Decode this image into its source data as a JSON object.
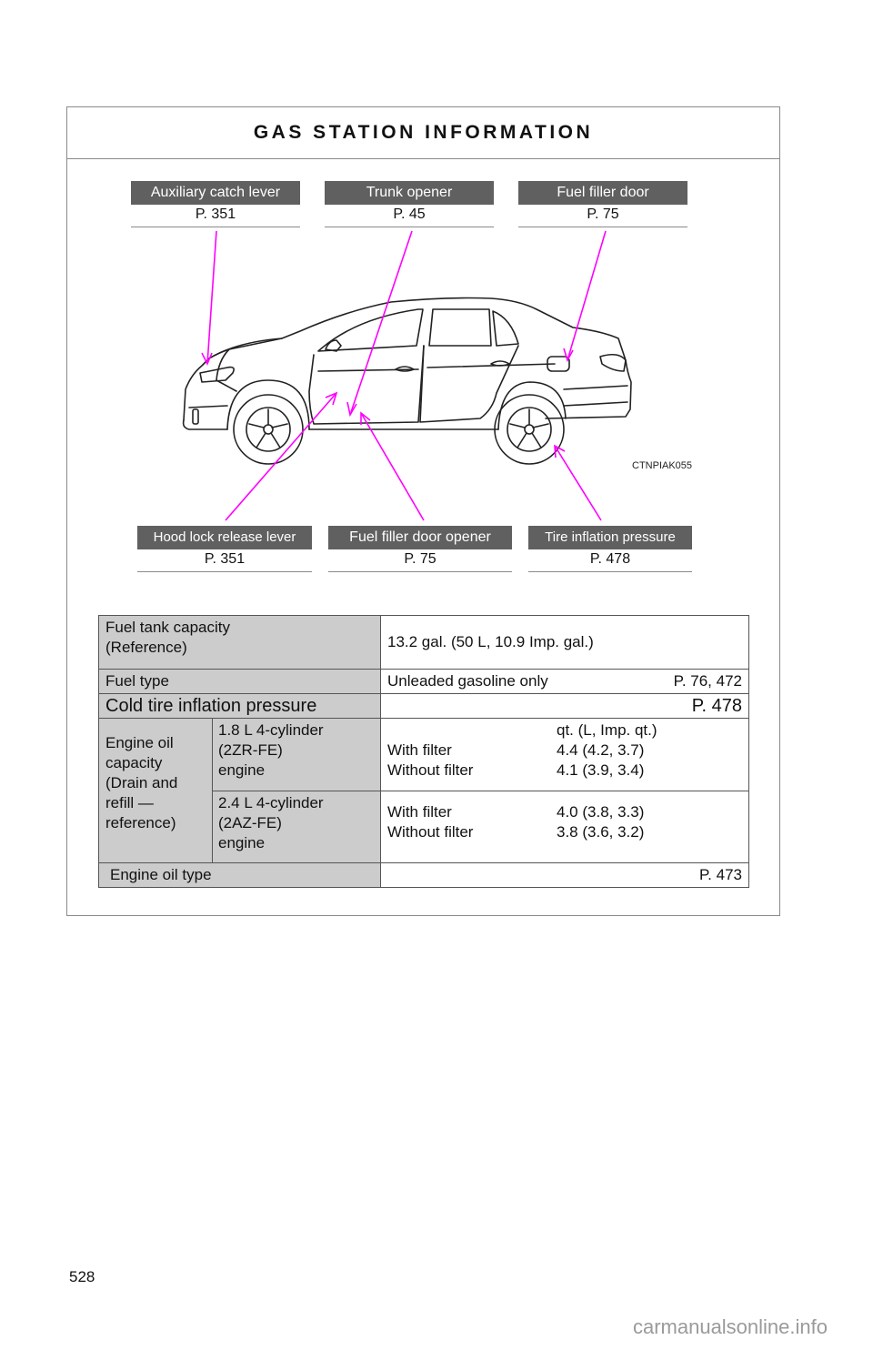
{
  "title": "GAS STATION INFORMATION",
  "callouts_top": [
    {
      "label": "Auxiliary catch lever",
      "page": "P. 351"
    },
    {
      "label": "Trunk opener",
      "page": "P. 45"
    },
    {
      "label": "Fuel filler door",
      "page": "P. 75"
    }
  ],
  "callouts_bottom": [
    {
      "label": "Hood lock release lever",
      "page": "P. 351"
    },
    {
      "label": "Fuel filler door opener",
      "page": "P. 75"
    },
    {
      "label": "Tire inflation pressure",
      "page": "P. 478"
    }
  ],
  "figure_code": "CTNPIAK055",
  "table": {
    "fuel_tank": {
      "label_line1": "Fuel tank capacity",
      "label_line2": "(Reference)",
      "value": "13.2 gal. (50 L, 10.9 Imp. gal.)"
    },
    "fuel_type": {
      "label": "Fuel type",
      "value": "Unleaded gasoline only",
      "ref": "P. 76, 472"
    },
    "cold_tire": {
      "label": "Cold tire inflation pressure",
      "ref": "P. 478"
    },
    "engine_oil": {
      "label_lines": [
        "Engine oil",
        "capacity",
        "(Drain and",
        "refill —",
        "reference)"
      ],
      "unit_header": "qt. (L, Imp. qt.)",
      "engines": [
        {
          "name_lines": [
            "1.8 L 4-cylinder",
            "(2ZR-FE)",
            "engine"
          ],
          "rows": [
            {
              "cond": "With filter",
              "amount": "4.4 (4.2, 3.7)"
            },
            {
              "cond": "Without filter",
              "amount": "4.1 (3.9, 3.4)"
            }
          ]
        },
        {
          "name_lines": [
            "2.4 L 4-cylinder",
            "(2AZ-FE)",
            "engine"
          ],
          "rows": [
            {
              "cond": "With filter",
              "amount": "4.0 (3.8, 3.3)"
            },
            {
              "cond": "Without filter",
              "amount": "3.8 (3.6, 3.2)"
            }
          ]
        }
      ]
    },
    "oil_type": {
      "label": "Engine oil type",
      "ref": "P. 473"
    }
  },
  "page_number": "528",
  "watermark": "carmanualsonline.info",
  "colors": {
    "callout_bg": "#606060",
    "pointer": "#ff00ff",
    "key_cell": "#cccccc"
  }
}
